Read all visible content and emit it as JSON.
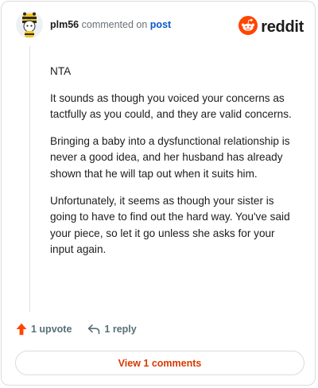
{
  "comment": {
    "username": "plm56",
    "action_text": "commented on",
    "post_link": "post",
    "avatar_icon": "bee-costume-avatar-icon",
    "paragraphs": [
      "NTA",
      "It sounds as though you voiced your concerns as tactfully as you could, and they are valid concerns.",
      "Bringing a baby into a dysfunctional relationship is never a good idea, and her husband has already shown that he will tap out when it suits him.",
      "Unfortunately, it seems as though your sister is going to have to find out the hard way. You've said your piece, so let it go unless she asks for your input again."
    ]
  },
  "brand": {
    "name": "reddit",
    "logo_icon": "reddit-alien-icon",
    "color": "#ff4500"
  },
  "actions": {
    "upvote_label": "1 upvote",
    "reply_label": "1 reply",
    "upvote_icon": "upvote-arrow-icon",
    "reply_icon": "reply-arrow-icon"
  },
  "footer": {
    "view_comments_label": "View 1 comments"
  },
  "colors": {
    "upvote": "#ff4500",
    "link": "#0a58ca",
    "view_button_text": "#d93a00"
  }
}
